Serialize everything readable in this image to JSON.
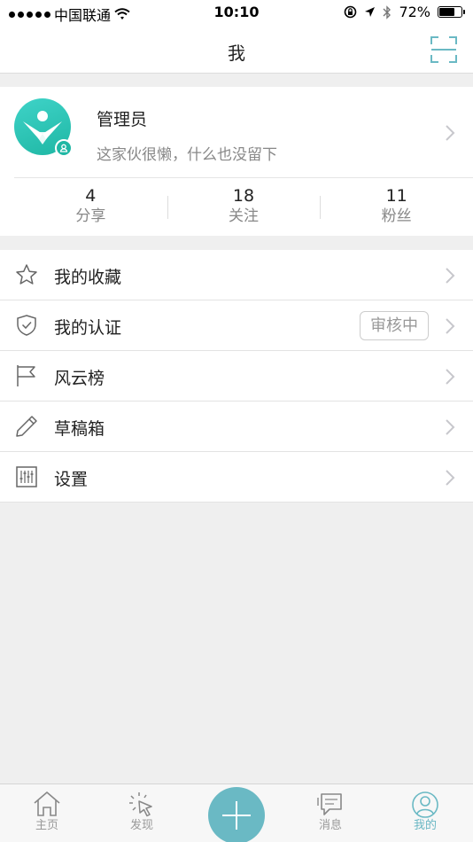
{
  "status_bar": {
    "carrier": "中国联通",
    "time": "10:10",
    "battery_percent": "72%",
    "battery_level": 0.72,
    "icons": [
      "signal-dots-icon",
      "wifi-icon",
      "orientation-lock-icon",
      "location-arrow-icon",
      "bluetooth-icon",
      "battery-icon"
    ]
  },
  "navbar": {
    "title": "我",
    "right_icon": "scan-icon"
  },
  "profile": {
    "name": "管理员",
    "signature": "这家伙很懒，什么也没留下",
    "stats": [
      {
        "value": "4",
        "label": "分享"
      },
      {
        "value": "18",
        "label": "关注"
      },
      {
        "value": "11",
        "label": "粉丝"
      }
    ]
  },
  "menu": [
    {
      "label": "我的收藏",
      "icon": "star-icon"
    },
    {
      "label": "我的认证",
      "icon": "shield-check-icon",
      "tag": "审核中"
    },
    {
      "label": "风云榜",
      "icon": "flag-icon"
    },
    {
      "label": "草稿箱",
      "icon": "pencil-icon"
    },
    {
      "label": "设置",
      "icon": "sliders-icon"
    }
  ],
  "tabbar": {
    "tabs": [
      {
        "label": "主页",
        "icon": "home-icon"
      },
      {
        "label": "发现",
        "icon": "cursor-click-icon"
      },
      {
        "label": "",
        "icon": "plus-icon"
      },
      {
        "label": "消息",
        "icon": "chat-icon"
      },
      {
        "label": "我的",
        "icon": "user-circle-icon"
      }
    ],
    "active_index": 4
  },
  "colors": {
    "accent": "#6ab9c4",
    "avatar_gradient": "#2cc6b6",
    "text_primary": "#222222",
    "text_secondary": "#888888",
    "background": "#efefef"
  }
}
